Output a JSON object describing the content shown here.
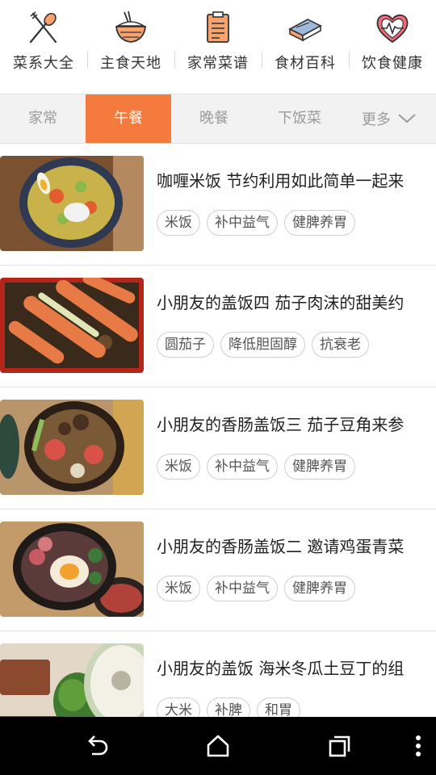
{
  "categories": [
    {
      "label": "菜系大全",
      "icon": "fork-spoon-icon"
    },
    {
      "label": "主食天地",
      "icon": "rice-bowl-icon"
    },
    {
      "label": "家常菜谱",
      "icon": "recipe-book-icon"
    },
    {
      "label": "食材百科",
      "icon": "encyclopedia-icon"
    },
    {
      "label": "饮食健康",
      "icon": "heart-health-icon"
    }
  ],
  "tabs": [
    {
      "label": "家常"
    },
    {
      "label": "午餐",
      "active": true
    },
    {
      "label": "晚餐"
    },
    {
      "label": "下饭菜"
    }
  ],
  "more_label": "更多",
  "recipes": [
    {
      "title": "咖喱米饭 节约利用如此简单一起来",
      "tags": [
        "米饭",
        "补中益气",
        "健脾养胃"
      ]
    },
    {
      "title": "小朋友的盖饭四 茄子肉沫的甜美约",
      "tags": [
        "圆茄子",
        "降低胆固醇",
        "抗衰老"
      ]
    },
    {
      "title": "小朋友的香肠盖饭三 茄子豆角来参",
      "tags": [
        "米饭",
        "补中益气",
        "健脾养胃"
      ]
    },
    {
      "title": "小朋友的香肠盖饭二 邀请鸡蛋青菜",
      "tags": [
        "米饭",
        "补中益气",
        "健脾养胃"
      ]
    },
    {
      "title": "小朋友的盖饭 海米冬瓜土豆丁的组",
      "tags": [
        "大米",
        "补脾",
        "和胃"
      ]
    }
  ],
  "colors": {
    "accent": "#f47b3d"
  }
}
